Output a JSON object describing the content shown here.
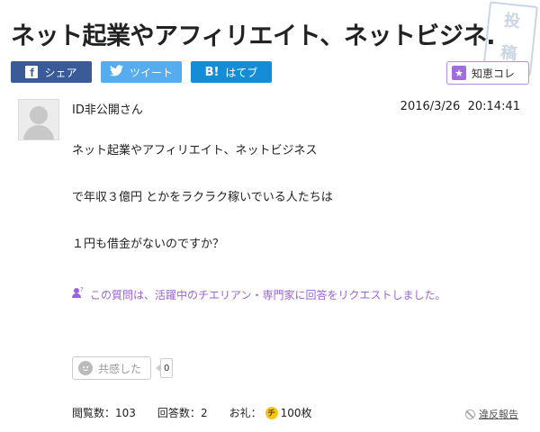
{
  "question": {
    "title": "ネット起業やアフィリエイト、ネットビジネ…",
    "body_lines": [
      "ネット起業やアフィリエイト、ネットビジネス",
      "で年収３億円 とかをラクラク稼いでいる人たちは",
      "１円も借金がないのですか？"
    ],
    "username": "ID非公開さん",
    "date": "2016/3/26",
    "time": "20:14:41",
    "request_notice": "この質問は、活躍中のチエリアン・専門家に回答をリクエストしました。"
  },
  "stamp": {
    "chars": [
      "投",
      "稿"
    ]
  },
  "share": {
    "facebook_label": "シェア",
    "twitter_label": "ツイート",
    "hatena_label": "はてブ",
    "hatena_mark": "B!",
    "facebook_mark": "f"
  },
  "chiekore": {
    "label": "知恵コレ",
    "star": "★"
  },
  "empathy": {
    "label": "共感した",
    "count": "0"
  },
  "stats": {
    "views_label": "閲覧数：",
    "views": "103",
    "answers_label": "回答数：",
    "answers": "2",
    "reward_label": "お礼：",
    "coin_char": "チ",
    "reward": "100枚"
  },
  "report_label": "違反報告",
  "colors": {
    "facebook": "#3b5a98",
    "twitter": "#55acee",
    "hatena": "#148dd6",
    "accent_purple": "#9b62d9"
  }
}
